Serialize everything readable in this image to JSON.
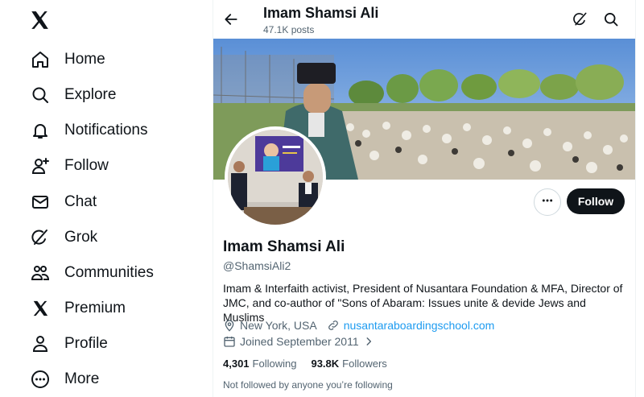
{
  "nav": {
    "logo": "x-logo",
    "items": [
      {
        "label": "Home",
        "icon": "home-icon"
      },
      {
        "label": "Explore",
        "icon": "search-icon"
      },
      {
        "label": "Notifications",
        "icon": "bell-icon"
      },
      {
        "label": "Follow",
        "icon": "person-plus-icon"
      },
      {
        "label": "Chat",
        "icon": "mail-icon"
      },
      {
        "label": "Grok",
        "icon": "grok-icon"
      },
      {
        "label": "Communities",
        "icon": "communities-icon"
      },
      {
        "label": "Premium",
        "icon": "x-premium-icon"
      },
      {
        "label": "Profile",
        "icon": "person-icon"
      },
      {
        "label": "More",
        "icon": "more-circle-icon"
      }
    ]
  },
  "header": {
    "name": "Imam Shamsi Ali",
    "posts": "47.1K posts"
  },
  "profile": {
    "name": "Imam Shamsi Ali",
    "handle": "@ShamsiAli2",
    "bio": "Imam & Interfaith activist, President of Nusantara Foundation & MFA, Director of JMC, and co-author of \"Sons of Abaram: Issues unite & devide Jews and Muslims",
    "location": "New York, USA",
    "website": "nusantaraboardingschool.com",
    "joined": "Joined September 2011",
    "following_count": "4,301",
    "following_label": "Following",
    "followers_count": "93.8K",
    "followers_label": "Followers",
    "followed_by": "Not followed by anyone you’re following",
    "follow_button": "Follow"
  },
  "colors": {
    "accent": "#1d9bf0",
    "text": "#0f1419",
    "muted": "#536471",
    "button_dark": "#0f1419"
  }
}
